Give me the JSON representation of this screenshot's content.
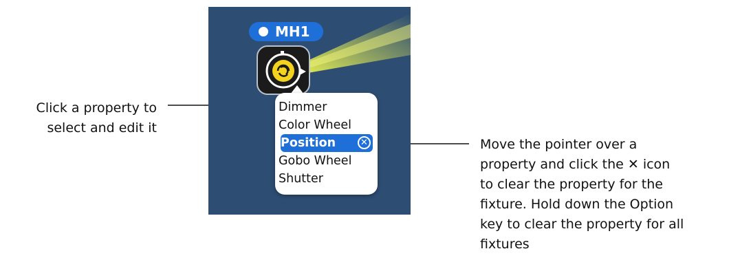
{
  "fixture": {
    "label": "MH1",
    "icon": "moving-head-icon"
  },
  "menu": {
    "items": [
      {
        "label": "Dimmer"
      },
      {
        "label": "Color Wheel"
      },
      {
        "label": "Position",
        "selected": true,
        "clear_icon": "x-circle-icon"
      },
      {
        "label": "Gobo Wheel"
      },
      {
        "label": "Shutter"
      }
    ]
  },
  "callouts": {
    "left_line1": "Click a property to",
    "left_line2": "select and edit it",
    "right_line1": "Move the pointer over a",
    "right_line2a": "property and click the ",
    "right_glyph": "✕",
    "right_line2b": " icon",
    "right_line3": "to clear the property for the",
    "right_line4": "fixture. Hold down the Option",
    "right_line5": "key to clear the property for all",
    "right_line6": "fixtures"
  },
  "colors": {
    "stage": "#2e4d73",
    "accent": "#1f6fd8",
    "beam": "#d8e04a"
  }
}
